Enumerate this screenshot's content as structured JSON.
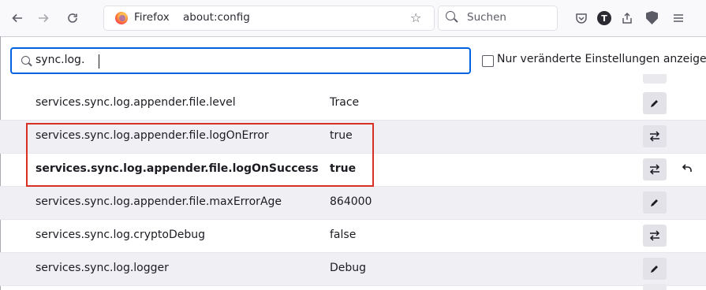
{
  "toolbar": {
    "back_icon": "arrow-left-icon",
    "forward_icon": "arrow-right-icon",
    "reload_icon": "reload-icon",
    "urlbar": {
      "brand": "Firefox",
      "url": "about:config"
    },
    "search": {
      "placeholder": "Suchen"
    },
    "profile_initial": "T"
  },
  "filter": {
    "value": "sync.log.",
    "show_modified_label": "Nur veränderte Einstellungen anzeigen"
  },
  "prefs": [
    {
      "name": "services.sync.log.appender.file.level",
      "value": "Trace",
      "action": "edit",
      "modified": false
    },
    {
      "name": "services.sync.log.appender.file.logOnError",
      "value": "true",
      "action": "toggle",
      "modified": false
    },
    {
      "name": "services.sync.log.appender.file.logOnSuccess",
      "value": "true",
      "action": "toggle",
      "modified": true
    },
    {
      "name": "services.sync.log.appender.file.maxErrorAge",
      "value": "864000",
      "action": "edit",
      "modified": false
    },
    {
      "name": "services.sync.log.cryptoDebug",
      "value": "false",
      "action": "toggle",
      "modified": false
    },
    {
      "name": "services.sync.log.logger",
      "value": "Debug",
      "action": "edit",
      "modified": false
    }
  ],
  "colors": {
    "accent": "#0061e0",
    "highlight": "#d93025"
  }
}
